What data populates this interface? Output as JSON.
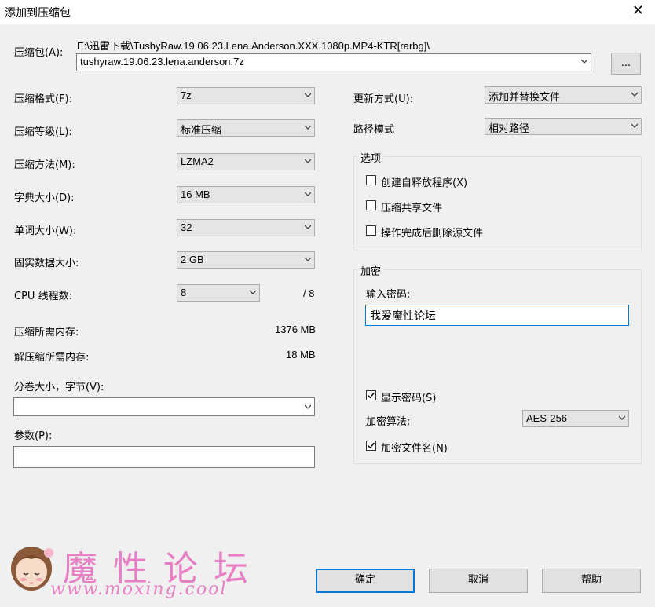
{
  "dialog": {
    "title": "添加到压缩包"
  },
  "archive": {
    "label": "压缩包(A):",
    "path": "E:\\迅雷下载\\TushyRaw.19.06.23.Lena.Anderson.XXX.1080p.MP4-KTR[rarbg]\\",
    "filename": "tushyraw.19.06.23.lena.anderson.7z",
    "browse_label": "..."
  },
  "left": {
    "format": {
      "label": "压缩格式(F):",
      "value": "7z"
    },
    "level": {
      "label": "压缩等级(L):",
      "value": "标准压缩"
    },
    "method": {
      "label": "压缩方法(M):",
      "value": "LZMA2"
    },
    "dict": {
      "label": "字典大小(D):",
      "value": "16 MB"
    },
    "word": {
      "label": "单词大小(W):",
      "value": "32"
    },
    "solid": {
      "label": "固实数据大小:",
      "value": "2 GB"
    },
    "threads": {
      "label": "CPU 线程数:",
      "value": "8",
      "total": "/ 8"
    },
    "mem_compress": {
      "label": "压缩所需内存:",
      "value": "1376 MB"
    },
    "mem_decompress": {
      "label": "解压缩所需内存:",
      "value": "18 MB"
    },
    "split": {
      "label": "分卷大小，字节(V):",
      "value": ""
    },
    "params": {
      "label": "参数(P):",
      "value": ""
    }
  },
  "right": {
    "update": {
      "label": "更新方式(U):",
      "value": "添加并替换文件"
    },
    "pathmode": {
      "label": "路径模式",
      "value": "相对路径"
    },
    "options": {
      "title": "选项",
      "sfx": {
        "label": "创建自释放程序(X)",
        "checked": false
      },
      "shared": {
        "label": "压缩共享文件",
        "checked": false
      },
      "delete": {
        "label": "操作完成后删除源文件",
        "checked": false
      }
    },
    "encryption": {
      "title": "加密",
      "password_label": "输入密码:",
      "password_value": "我爱魔性论坛",
      "show_password": {
        "label": "显示密码(S)",
        "checked": true
      },
      "method_label": "加密算法:",
      "method_value": "AES-256",
      "encrypt_names": {
        "label": "加密文件名(N)",
        "checked": true
      }
    }
  },
  "buttons": {
    "ok": "确定",
    "cancel": "取消",
    "help": "帮助"
  },
  "watermark": {
    "text": "魔性论坛",
    "url": "www.moxing.cool"
  },
  "colors": {
    "accent": "#0078d7",
    "watermark": "#e87ec3"
  }
}
